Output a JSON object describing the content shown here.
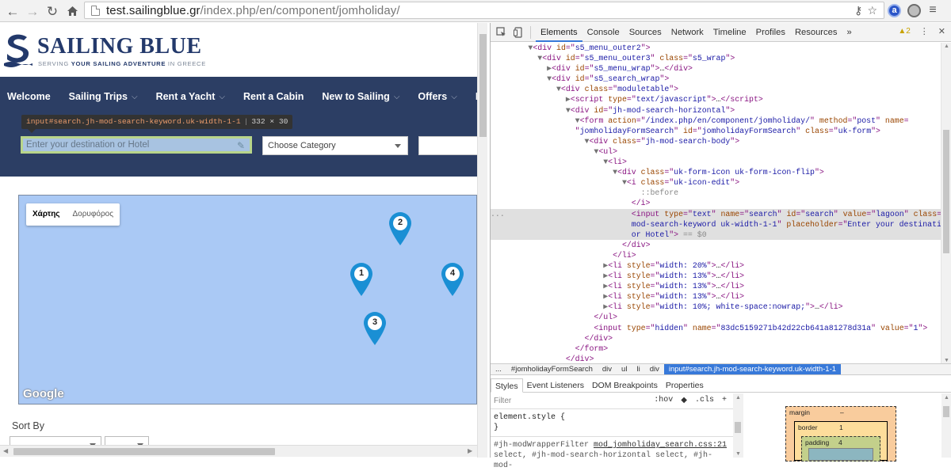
{
  "browser": {
    "url_host": "test.sailingblue.gr",
    "url_path": "/index.php/en/component/jomholiday/",
    "icons": [
      "back-icon",
      "forward-icon",
      "reload-icon",
      "home-icon",
      "page-icon",
      "key-icon",
      "star-icon",
      "extension-icon",
      "globe-extension-icon",
      "menu-icon"
    ],
    "ext_a_label": "a"
  },
  "site": {
    "logo_name": "SAILING BLUE",
    "logo_tagline_pre": "SERVING ",
    "logo_tagline_bold": "YOUR SAILING ADVENTURE",
    "logo_tagline_post": " IN GREECE",
    "brand_color": "#23396b",
    "nav_color": "#2c3e64",
    "menu": [
      {
        "label": "Welcome",
        "dropdown": false
      },
      {
        "label": "Sailing Trips",
        "dropdown": true
      },
      {
        "label": "Rent a Yacht",
        "dropdown": true
      },
      {
        "label": "Rent a Cabin",
        "dropdown": false
      },
      {
        "label": "New to Sailing",
        "dropdown": true
      },
      {
        "label": "Offers",
        "dropdown": true
      },
      {
        "label": "In",
        "dropdown": false
      }
    ],
    "tooltip": {
      "selector": "input#search.jh-mod-search-keyword.uk-width-1-1",
      "dims": "332 × 30"
    },
    "search": {
      "placeholder": "Enter your destination or Hotel",
      "value": ""
    },
    "category": {
      "selected": "Choose Category"
    },
    "map": {
      "type_options": [
        {
          "label": "Χάρτης",
          "active": true
        },
        {
          "label": "Δορυφόρος",
          "active": false
        }
      ],
      "markers": [
        "1",
        "2",
        "3",
        "4"
      ],
      "attribution": "Google",
      "water_color": "#aac9f5",
      "marker_color": "#1a8fd4"
    },
    "sort_by_label": "Sort By"
  },
  "devtools": {
    "tabs": [
      {
        "label": "Elements",
        "active": true
      },
      {
        "label": "Console",
        "active": false
      },
      {
        "label": "Sources",
        "active": false
      },
      {
        "label": "Network",
        "active": false
      },
      {
        "label": "Timeline",
        "active": false
      },
      {
        "label": "Profiles",
        "active": false
      },
      {
        "label": "Resources",
        "active": false
      }
    ],
    "more_tabs": "»",
    "warnings": "▲2",
    "breadcrumbs": [
      {
        "label": "...",
        "selected": false
      },
      {
        "label": "#jomholidayFormSearch",
        "selected": false
      },
      {
        "label": "div",
        "selected": false
      },
      {
        "label": "ul",
        "selected": false
      },
      {
        "label": "li",
        "selected": false
      },
      {
        "label": "div",
        "selected": false
      },
      {
        "label": "input#search.jh-mod-search-keyword.uk-width-1-1",
        "selected": true
      }
    ],
    "styles_tabs": [
      {
        "label": "Styles",
        "active": true
      },
      {
        "label": "Event Listeners",
        "active": false
      },
      {
        "label": "DOM Breakpoints",
        "active": false
      },
      {
        "label": "Properties",
        "active": false
      }
    ],
    "filter_placeholder": "Filter",
    "filter_hov": ":hov",
    "filter_cls": ".cls",
    "filter_add": "+",
    "element_style": "element.style {",
    "element_style_close": "}",
    "rule_selector": "#jh-modWrapperFilter",
    "rule_source": "mod_jomholiday_search.css:21",
    "rule_selector_2": "select, #jh-mod-search-horizontal select, #jh-mod-",
    "box_model": {
      "margin_label": "margin",
      "margin_value": "–",
      "border_label": "border",
      "border_value": "1",
      "padding_label": "padding",
      "padding_value": "4"
    }
  }
}
